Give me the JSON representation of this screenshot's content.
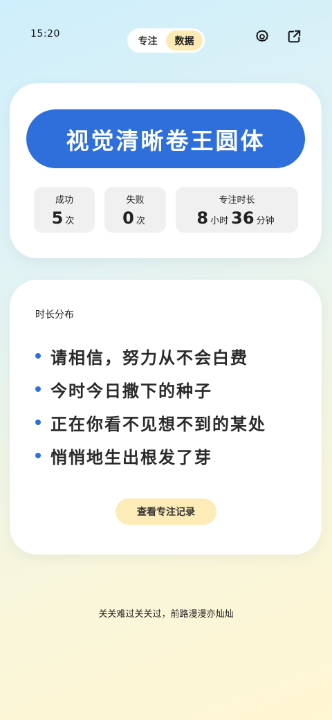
{
  "status_bar": {
    "time": "15:20"
  },
  "tabs": [
    {
      "label": "专注",
      "active": false
    },
    {
      "label": "数据",
      "active": true
    }
  ],
  "icons": {
    "settings": "gear-icon",
    "share": "share-icon"
  },
  "summary": {
    "title": "视觉清晰卷王圆体",
    "stats": {
      "success": {
        "label": "成功",
        "value": "5",
        "unit": "次"
      },
      "fail": {
        "label": "失败",
        "value": "0",
        "unit": "次"
      },
      "focus_time": {
        "label": "专注时长",
        "hours": "8",
        "hours_unit": "小时",
        "minutes": "36",
        "minutes_unit": "分钟"
      }
    }
  },
  "distribution": {
    "label": "时长分布",
    "lines": [
      "请相信，努力从不会白费",
      "今时今日撒下的种子",
      "正在你看不见想不到的某处",
      "悄悄地生出根发了芽"
    ],
    "button_label": "查看专注记录"
  },
  "footer": {
    "text": "关关难过关关过，前路漫漫亦灿灿"
  },
  "colors": {
    "accent": "#2e6fdc",
    "button_bg": "#fdecb8",
    "card_bg": "#ffffff",
    "stat_bg": "#f0f0f0"
  }
}
